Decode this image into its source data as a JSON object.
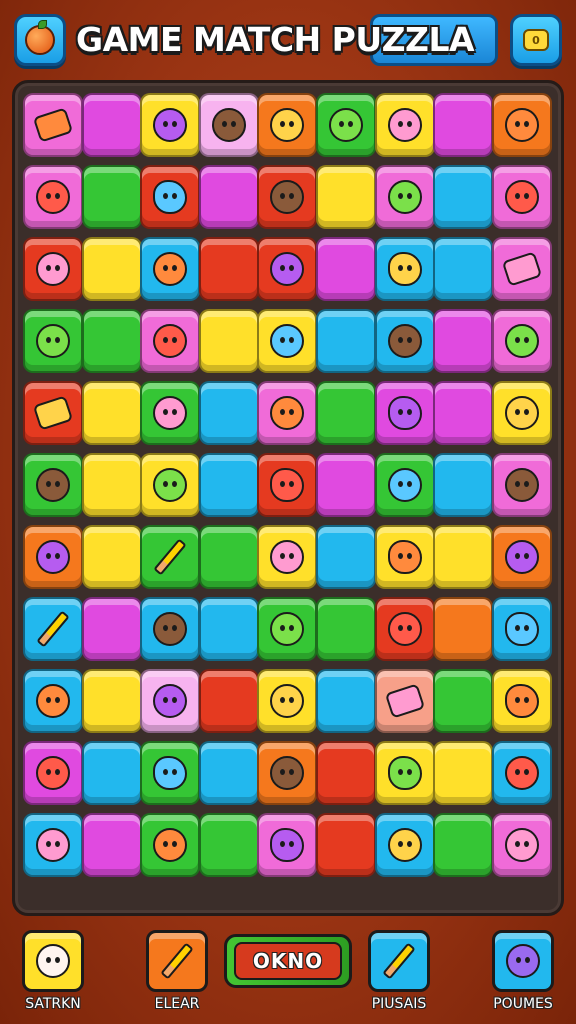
{
  "header": {
    "title": "GAME MATCH PUZZLA",
    "left_button_icon": "orange-fruit-icon",
    "right_button_icon": "coin-icon",
    "right_button_text": "0"
  },
  "colors": {
    "pink": "#f06bd8",
    "magenta": "#e04ae0",
    "yellow": "#ffe02a",
    "orange": "#f5781d",
    "green": "#35c635",
    "cyan": "#22b8ee",
    "red": "#e53a20",
    "lightpink": "#f7b3ef",
    "peach": "#f7a089"
  },
  "board": {
    "columns": 9,
    "rows": 11,
    "grid": [
      [
        [
          "pink",
          "bar"
        ],
        [
          "magenta",
          ""
        ],
        [
          "yellow",
          "creature"
        ],
        [
          "lightpink",
          "creature"
        ],
        [
          "orange",
          "creature"
        ],
        [
          "green",
          "creature"
        ],
        [
          "yellow",
          "creature"
        ],
        [
          "magenta",
          ""
        ],
        [
          "orange",
          "creature"
        ]
      ],
      [
        [
          "pink",
          "creature"
        ],
        [
          "green",
          ""
        ],
        [
          "red",
          "fruit"
        ],
        [
          "magenta",
          ""
        ],
        [
          "red",
          "creature"
        ],
        [
          "yellow",
          ""
        ],
        [
          "pink",
          "creature"
        ],
        [
          "cyan",
          ""
        ],
        [
          "pink",
          "creature"
        ]
      ],
      [
        [
          "red",
          "creature"
        ],
        [
          "yellow",
          ""
        ],
        [
          "cyan",
          "creature"
        ],
        [
          "red",
          ""
        ],
        [
          "red",
          "creature"
        ],
        [
          "magenta",
          ""
        ],
        [
          "cyan",
          "fruit"
        ],
        [
          "cyan",
          ""
        ],
        [
          "pink",
          "bar"
        ]
      ],
      [
        [
          "green",
          "creature"
        ],
        [
          "green",
          ""
        ],
        [
          "pink",
          "creature"
        ],
        [
          "yellow",
          ""
        ],
        [
          "yellow",
          "creature"
        ],
        [
          "cyan",
          ""
        ],
        [
          "cyan",
          "creature"
        ],
        [
          "magenta",
          ""
        ],
        [
          "pink",
          "creature"
        ]
      ],
      [
        [
          "red",
          "bar"
        ],
        [
          "yellow",
          ""
        ],
        [
          "green",
          "creature"
        ],
        [
          "cyan",
          ""
        ],
        [
          "pink",
          "creature"
        ],
        [
          "green",
          ""
        ],
        [
          "magenta",
          "fruit"
        ],
        [
          "magenta",
          ""
        ],
        [
          "yellow",
          "creature"
        ]
      ],
      [
        [
          "green",
          "creature"
        ],
        [
          "yellow",
          ""
        ],
        [
          "yellow",
          "creature"
        ],
        [
          "cyan",
          ""
        ],
        [
          "red",
          "fruit"
        ],
        [
          "magenta",
          ""
        ],
        [
          "green",
          "creature"
        ],
        [
          "cyan",
          ""
        ],
        [
          "pink",
          "creature"
        ]
      ],
      [
        [
          "orange",
          "creature"
        ],
        [
          "yellow",
          ""
        ],
        [
          "green",
          "pencil"
        ],
        [
          "green",
          ""
        ],
        [
          "yellow",
          "creature"
        ],
        [
          "cyan",
          ""
        ],
        [
          "yellow",
          "fruit"
        ],
        [
          "yellow",
          ""
        ],
        [
          "orange",
          "creature"
        ]
      ],
      [
        [
          "cyan",
          "pencil"
        ],
        [
          "magenta",
          ""
        ],
        [
          "cyan",
          "creature"
        ],
        [
          "cyan",
          ""
        ],
        [
          "green",
          "creature"
        ],
        [
          "green",
          ""
        ],
        [
          "red",
          "creature"
        ],
        [
          "orange",
          ""
        ],
        [
          "cyan",
          "fruit"
        ]
      ],
      [
        [
          "cyan",
          "creature"
        ],
        [
          "yellow",
          ""
        ],
        [
          "lightpink",
          "creature"
        ],
        [
          "red",
          ""
        ],
        [
          "yellow",
          "creature"
        ],
        [
          "cyan",
          ""
        ],
        [
          "peach",
          "bar"
        ],
        [
          "green",
          ""
        ],
        [
          "yellow",
          "fruit"
        ]
      ],
      [
        [
          "magenta",
          "creature"
        ],
        [
          "cyan",
          ""
        ],
        [
          "green",
          "fruit"
        ],
        [
          "cyan",
          ""
        ],
        [
          "orange",
          "creature"
        ],
        [
          "red",
          ""
        ],
        [
          "yellow",
          "fruit"
        ],
        [
          "yellow",
          ""
        ],
        [
          "cyan",
          "creature"
        ]
      ],
      [
        [
          "cyan",
          "creature"
        ],
        [
          "magenta",
          ""
        ],
        [
          "green",
          "creature"
        ],
        [
          "green",
          ""
        ],
        [
          "pink",
          "fruit"
        ],
        [
          "red",
          ""
        ],
        [
          "cyan",
          "creature"
        ],
        [
          "green",
          ""
        ],
        [
          "pink",
          "creature"
        ]
      ]
    ]
  },
  "bottom_bar": {
    "buttons": [
      {
        "label": "SATRKN",
        "icon": "cat-face-icon",
        "color": "#ffe02a"
      },
      {
        "label": "ELEAR",
        "icon": "pencil-icon",
        "color": "#f5781d"
      },
      {
        "label": "PIUSAIS",
        "icon": "pencil-icon",
        "color": "#22b8ee"
      },
      {
        "label": "POUMES",
        "icon": "cat-face-icon",
        "color": "#22b8ee"
      }
    ],
    "score": "OKNO"
  }
}
